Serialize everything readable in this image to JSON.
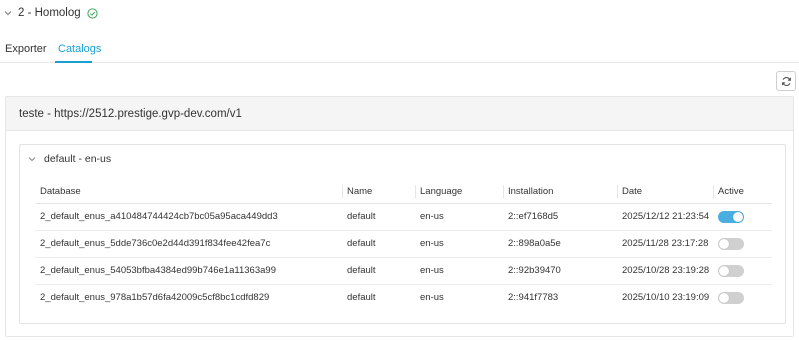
{
  "environment": {
    "title": "2 - Homolog",
    "status_icon": "check-circle-icon",
    "status_color": "#3ca55c"
  },
  "tabs": [
    {
      "label": "Exporter",
      "active": false
    },
    {
      "label": "Catalogs",
      "active": true
    }
  ],
  "accent_color": "#1a9fd0",
  "refresh_icon": "refresh-icon",
  "connection": {
    "title": "teste - https://2512.prestige.gvp-dev.com/v1"
  },
  "group": {
    "title": "default - en-us",
    "columns": [
      "Database",
      "Name",
      "Language",
      "Installation",
      "Date",
      "Active"
    ],
    "rows": [
      {
        "database": "2_default_enus_a410484744424cb7bc05a95aca449dd3",
        "name": "default",
        "language": "en-us",
        "installation": "2::ef7168d5",
        "date": "2025/12/12 21:23:54",
        "active": true
      },
      {
        "database": "2_default_enus_5dde736c0e2d44d391f834fee42fea7c",
        "name": "default",
        "language": "en-us",
        "installation": "2::898a0a5e",
        "date": "2025/11/28 23:17:28",
        "active": false
      },
      {
        "database": "2_default_enus_54053bfba4384ed99b746e1a11363a99",
        "name": "default",
        "language": "en-us",
        "installation": "2::92b39470",
        "date": "2025/10/28 23:19:28",
        "active": false
      },
      {
        "database": "2_default_enus_978a1b57d6fa42009c5cf8bc1cdfd829",
        "name": "default",
        "language": "en-us",
        "installation": "2::941f7783",
        "date": "2025/10/10 23:19:09",
        "active": false
      }
    ]
  }
}
